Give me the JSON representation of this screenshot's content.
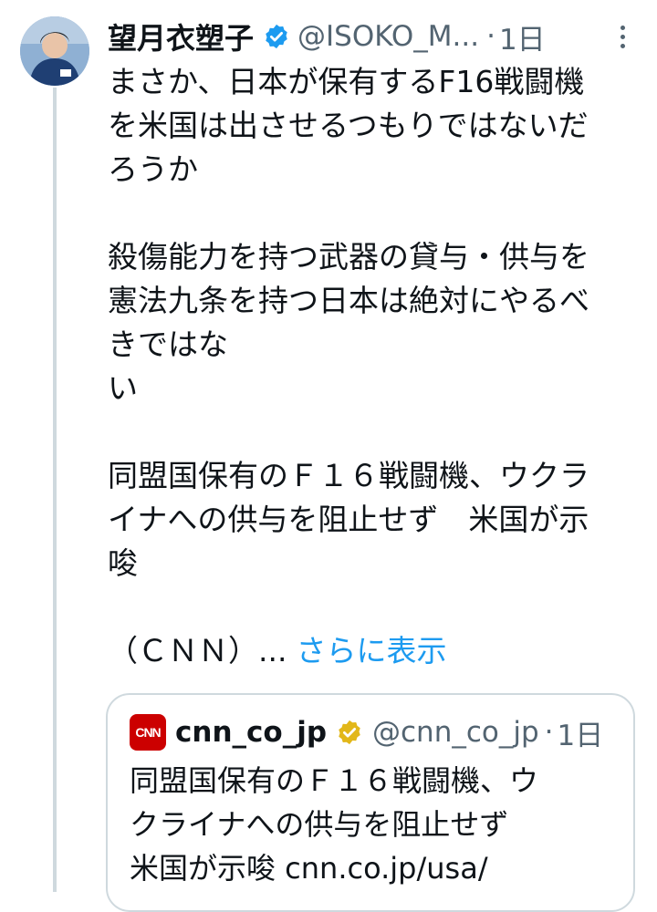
{
  "tweet": {
    "author": {
      "display_name": "望月衣塑子",
      "handle": "@ISOKO_M...",
      "verified_icon": "verified-badge-icon",
      "verified_color": "#1d9bf0"
    },
    "time": "1日",
    "separator": "·",
    "text_lines": [
      "まさか、日本が保有するF16戦闘機",
      "を米国は出させるつもりではないだ",
      "ろうか",
      "殺傷能力を持つ武器の貸与・供与を",
      "憲法九条を持つ日本は絶対にやるべ",
      "きではな",
      "い",
      "同盟国保有のＦ１６戦闘機、ウクラ",
      "イナへの供与を阻止せず　米国が示",
      "唆",
      "（ＣＮＮ）..."
    ],
    "show_more_label": "さらに表示",
    "link_color": "#1d9bf0"
  },
  "quote": {
    "logo_text": "CNN",
    "display_name": "cnn_co_jp",
    "handle": "@cnn_co_jp",
    "separator": "·",
    "time": "1日",
    "verified_icon": "gold-verified-badge-icon",
    "verified_color": "#e2b719",
    "text_lines": [
      "同盟国保有のＦ１６戦闘機、ウ",
      "クライナへの供与を阻止せず",
      "米国が示唆 cnn.co.jp/usa/"
    ]
  }
}
